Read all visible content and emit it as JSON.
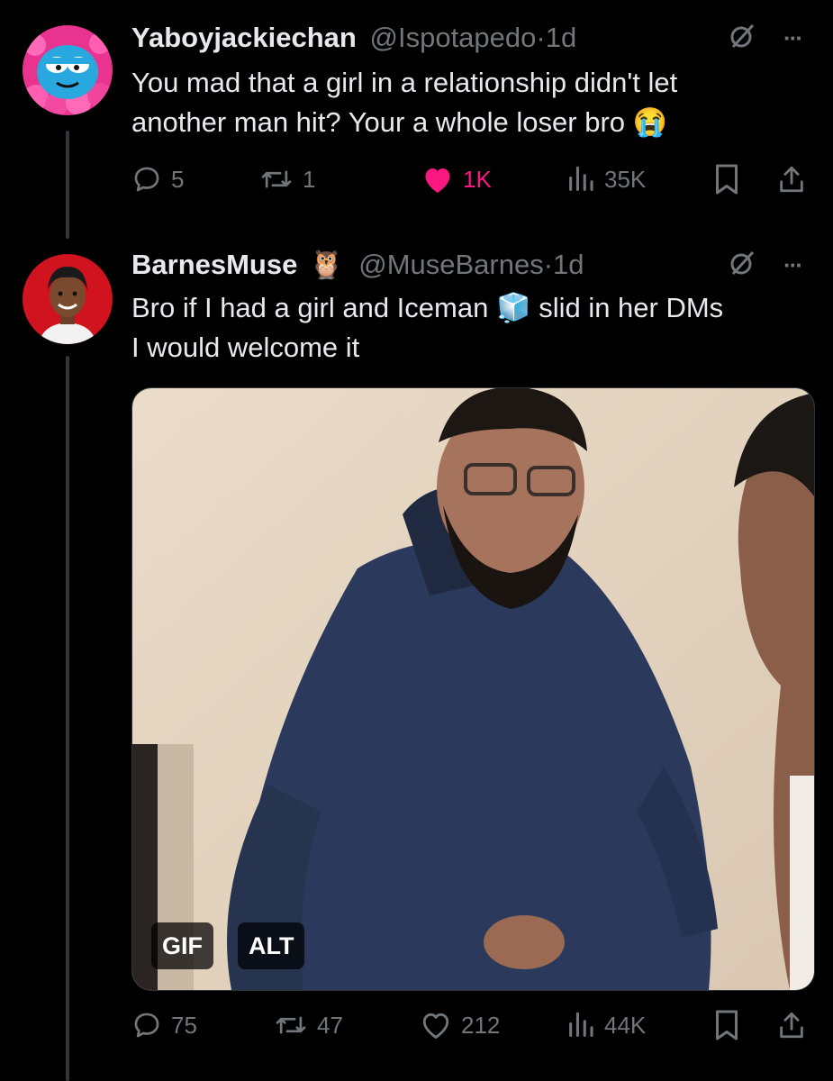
{
  "tweets": [
    {
      "author": "Yaboyjackiechan",
      "handle": "@Ispotapedo",
      "time": "1d",
      "text_line1": "You mad that a girl in a relationship didn't let",
      "text_line2": "another man hit? Your a whole loser bro",
      "emoji": "😭",
      "replies": "5",
      "reposts": "1",
      "likes": "1K",
      "views": "35K",
      "liked": true
    },
    {
      "author": "BarnesMuse",
      "author_emoji": "🦉",
      "handle": "@MuseBarnes",
      "time": "1d",
      "text_line1_a": "Bro if I had a girl and Iceman",
      "text_line1_emoji": "🧊",
      "text_line1_b": "slid in her DMs",
      "text_line2": "I would welcome it",
      "media_badges": [
        "GIF",
        "ALT"
      ],
      "replies": "75",
      "reposts": "47",
      "likes": "212",
      "views": "44K",
      "liked": false
    }
  ],
  "separator": "·",
  "more_glyph": "···",
  "colors": {
    "like_pink": "#f91880",
    "muted": "#71767b",
    "text": "#e7e9ea"
  }
}
